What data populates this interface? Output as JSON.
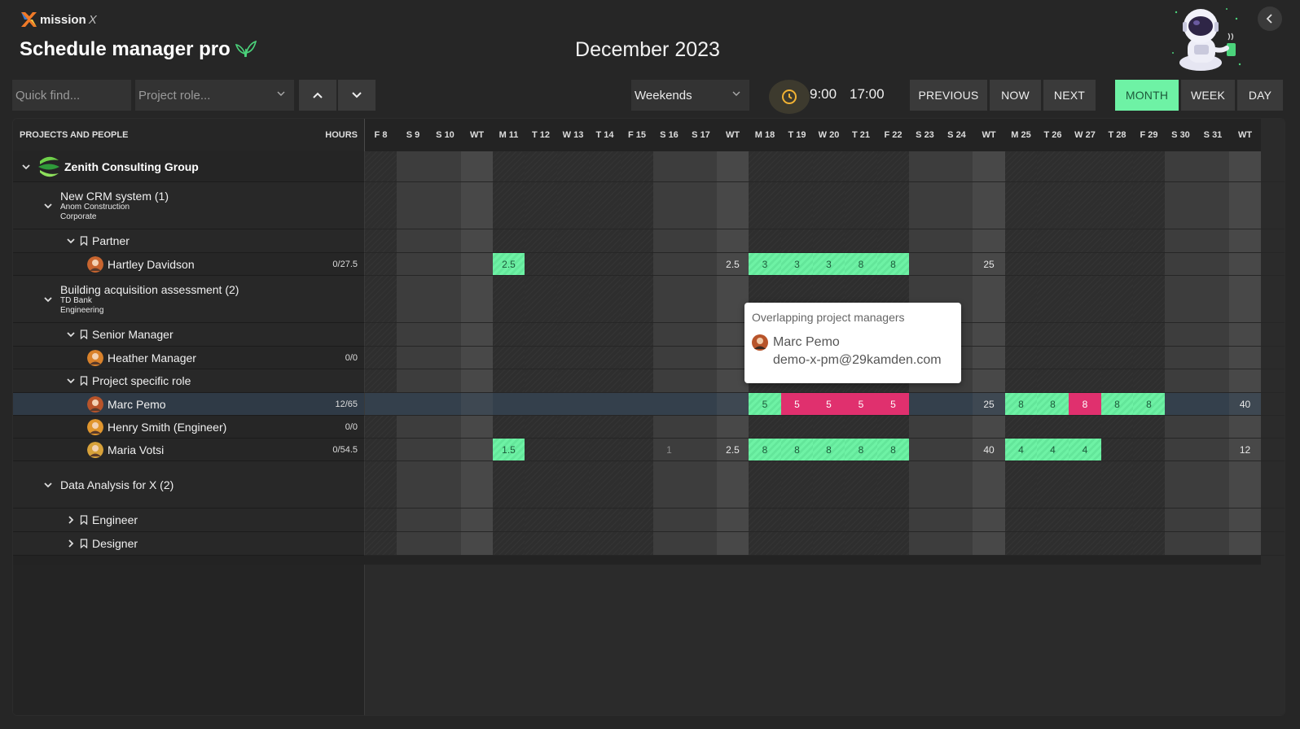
{
  "app": {
    "logo_text": "mission",
    "logo_x": "X",
    "title": "Schedule manager pro",
    "month_title": "December 2023"
  },
  "toolbar": {
    "quick_find_placeholder": "Quick find...",
    "project_role_placeholder": "Project role...",
    "weekends_value": "Weekends",
    "start_time": "9:00",
    "end_time": "17:00",
    "previous_label": "PREVIOUS",
    "now_label": "NOW",
    "next_label": "NEXT",
    "month_label": "MONTH",
    "week_label": "WEEK",
    "day_label": "DAY",
    "active_view": "month"
  },
  "grid": {
    "left_header": "PROJECTS AND PEOPLE",
    "hours_header": "HOURS",
    "days": [
      {
        "label": "F 8",
        "type": "weekday"
      },
      {
        "label": "S 9",
        "type": "weekend"
      },
      {
        "label": "S 10",
        "type": "weekend"
      },
      {
        "label": "WT",
        "type": "wt"
      },
      {
        "label": "M 11",
        "type": "weekday"
      },
      {
        "label": "T 12",
        "type": "weekday"
      },
      {
        "label": "W 13",
        "type": "weekday"
      },
      {
        "label": "T 14",
        "type": "weekday"
      },
      {
        "label": "F 15",
        "type": "weekday"
      },
      {
        "label": "S 16",
        "type": "weekend"
      },
      {
        "label": "S 17",
        "type": "weekend"
      },
      {
        "label": "WT",
        "type": "wt"
      },
      {
        "label": "M 18",
        "type": "weekday"
      },
      {
        "label": "T 19",
        "type": "weekday"
      },
      {
        "label": "W 20",
        "type": "weekday"
      },
      {
        "label": "T 21",
        "type": "weekday"
      },
      {
        "label": "F 22",
        "type": "weekday"
      },
      {
        "label": "S 23",
        "type": "weekend"
      },
      {
        "label": "S 24",
        "type": "weekend"
      },
      {
        "label": "WT",
        "type": "wt"
      },
      {
        "label": "M 25",
        "type": "weekday"
      },
      {
        "label": "T 26",
        "type": "weekday"
      },
      {
        "label": "W 27",
        "type": "weekday"
      },
      {
        "label": "T 28",
        "type": "weekday"
      },
      {
        "label": "F 29",
        "type": "weekday"
      },
      {
        "label": "S 30",
        "type": "weekend"
      },
      {
        "label": "S 31",
        "type": "weekend"
      },
      {
        "label": "WT",
        "type": "wt"
      }
    ],
    "rows": [
      {
        "kind": "org",
        "name": "Zenith Consulting Group",
        "chevron": "down"
      },
      {
        "kind": "project",
        "name": "New CRM system (1)",
        "client": "Anom Construction",
        "category": "Corporate",
        "chevron": "down"
      },
      {
        "kind": "role",
        "name": "Partner",
        "chevron": "down"
      },
      {
        "kind": "person",
        "name": "Hartley Davidson",
        "hours": "0/27.5",
        "avatar_color": "#c8652f",
        "cells": [
          {
            "col": 4,
            "v": "2.5",
            "s": "green"
          },
          {
            "col": 11,
            "v": "2.5",
            "s": ""
          },
          {
            "col": 12,
            "v": "3",
            "s": "green"
          },
          {
            "col": 13,
            "v": "3",
            "s": "green"
          },
          {
            "col": 14,
            "v": "3",
            "s": "green"
          },
          {
            "col": 15,
            "v": "8",
            "s": "green"
          },
          {
            "col": 16,
            "v": "8",
            "s": "green"
          },
          {
            "col": 19,
            "v": "25",
            "s": ""
          }
        ]
      },
      {
        "kind": "project",
        "name": "Building acquisition assessment (2)",
        "client": "TD Bank",
        "category": "Engineering",
        "chevron": "down"
      },
      {
        "kind": "role",
        "name": "Senior Manager",
        "chevron": "down"
      },
      {
        "kind": "person",
        "name": "Heather Manager",
        "hours": "0/0",
        "avatar_color": "#d9822b",
        "cells": []
      },
      {
        "kind": "role",
        "name": "Project specific role",
        "chevron": "down"
      },
      {
        "kind": "person",
        "name": "Marc Pemo",
        "hours": "12/65",
        "avatar_color": "#b8542a",
        "selected": true,
        "cells": [
          {
            "col": 12,
            "v": "5",
            "s": "green"
          },
          {
            "col": 13,
            "v": "5",
            "s": "red"
          },
          {
            "col": 14,
            "v": "5",
            "s": "red"
          },
          {
            "col": 15,
            "v": "5",
            "s": "red"
          },
          {
            "col": 16,
            "v": "5",
            "s": "red"
          },
          {
            "col": 19,
            "v": "25",
            "s": ""
          },
          {
            "col": 20,
            "v": "8",
            "s": "green"
          },
          {
            "col": 21,
            "v": "8",
            "s": "green"
          },
          {
            "col": 22,
            "v": "8",
            "s": "red"
          },
          {
            "col": 23,
            "v": "8",
            "s": "green"
          },
          {
            "col": 24,
            "v": "8",
            "s": "green"
          },
          {
            "col": 27,
            "v": "40",
            "s": ""
          }
        ]
      },
      {
        "kind": "person",
        "name": "Henry Smith (Engineer)",
        "hours": "0/0",
        "avatar_color": "#e0962e",
        "cells": []
      },
      {
        "kind": "person",
        "name": "Maria Votsi",
        "hours": "0/54.5",
        "avatar_color": "#d8a23a",
        "cells": [
          {
            "col": 4,
            "v": "1.5",
            "s": "green"
          },
          {
            "col": 9,
            "v": "1",
            "s": "dim"
          },
          {
            "col": 11,
            "v": "2.5",
            "s": ""
          },
          {
            "col": 12,
            "v": "8",
            "s": "green"
          },
          {
            "col": 13,
            "v": "8",
            "s": "green"
          },
          {
            "col": 14,
            "v": "8",
            "s": "green"
          },
          {
            "col": 15,
            "v": "8",
            "s": "green"
          },
          {
            "col": 16,
            "v": "8",
            "s": "green"
          },
          {
            "col": 19,
            "v": "40",
            "s": ""
          },
          {
            "col": 20,
            "v": "4",
            "s": "green"
          },
          {
            "col": 21,
            "v": "4",
            "s": "green"
          },
          {
            "col": 22,
            "v": "4",
            "s": "green"
          },
          {
            "col": 27,
            "v": "12",
            "s": ""
          }
        ]
      },
      {
        "kind": "project",
        "name": "Data Analysis for X (2)",
        "client": "",
        "category": "",
        "chevron": "down"
      },
      {
        "kind": "role",
        "name": "Engineer",
        "chevron": "right"
      },
      {
        "kind": "role",
        "name": "Designer",
        "chevron": "right"
      }
    ]
  },
  "tooltip": {
    "title": "Overlapping project managers",
    "name": "Marc Pemo",
    "email": "demo-x-pm@29kamden.com"
  },
  "colors": {
    "accent_green": "#6ef2a5",
    "overlap_red": "#e0306e",
    "background": "#262626"
  }
}
